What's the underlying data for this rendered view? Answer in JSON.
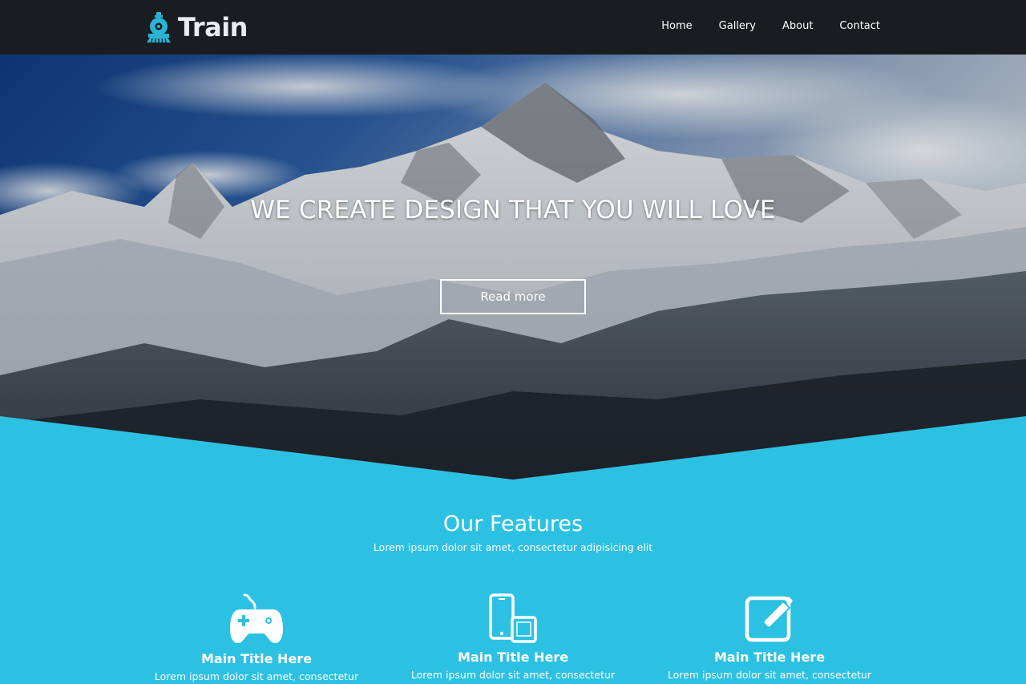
{
  "header": {
    "logo_text": "Train",
    "nav": [
      "Home",
      "Gallery",
      "About",
      "Contact"
    ]
  },
  "hero": {
    "title": "WE CREATE DESIGN THAT YOU WILL LOVE",
    "button_label": "Read more"
  },
  "features": {
    "title": "Our Features",
    "subtitle": "Lorem ipsum dolor sit amet, consectetur adipisicing elit",
    "items": [
      {
        "icon": "gamepad-icon",
        "title": "Main Title Here",
        "text": "Lorem ipsum dolor sit amet, consectetur"
      },
      {
        "icon": "devices-icon",
        "title": "Main Title Here",
        "text": "Lorem ipsum dolor sit amet, consectetur"
      },
      {
        "icon": "edit-icon",
        "title": "Main Title Here",
        "text": "Lorem ipsum dolor sit amet, consectetur"
      }
    ]
  },
  "colors": {
    "navbar": "#1a1d20",
    "accent": "#2cc1e3",
    "logo_icon": "#2ab3d5"
  }
}
